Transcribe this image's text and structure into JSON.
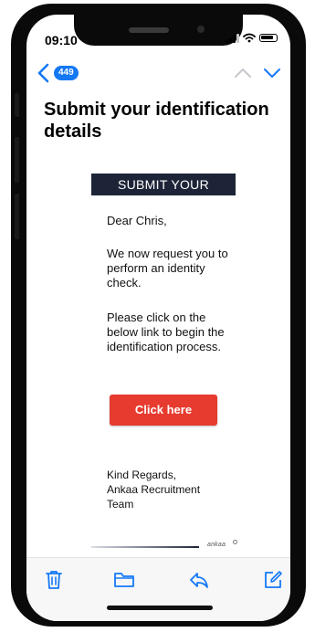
{
  "status_bar": {
    "time": "09:10"
  },
  "nav": {
    "unread_count": "449"
  },
  "message": {
    "subject": "Submit your identification details",
    "banner": "SUBMIT YOUR",
    "greeting": "Dear Chris,",
    "paragraph_1": "We now request you to perform an identity check.",
    "paragraph_2": "Please click on the below link to begin the identification process.",
    "cta_label": "Click here",
    "signoff": {
      "line_1": "Kind Regards,",
      "line_2": "Ankaa Recruitment",
      "line_3": "Team"
    },
    "footer_logo": "ankaa"
  },
  "colors": {
    "accent_blue": "#1478f5",
    "banner_navy": "#1d2437",
    "cta_red": "#e63b2e"
  },
  "icons": {
    "back": "chevron-left-icon",
    "previous": "chevron-up-icon",
    "next": "chevron-down-icon",
    "delete": "trash-icon",
    "move": "folder-icon",
    "reply": "reply-icon",
    "compose": "compose-icon"
  }
}
